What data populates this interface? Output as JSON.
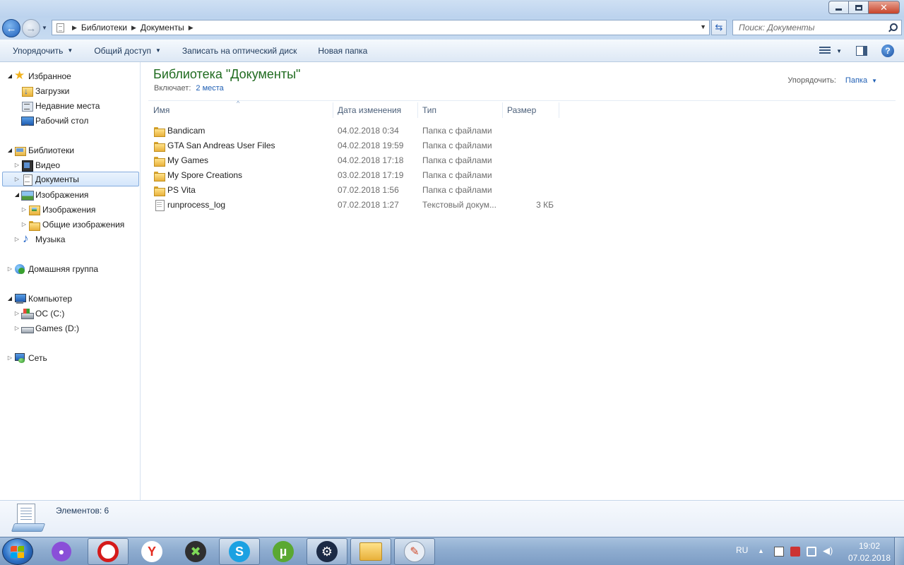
{
  "window": {
    "minimize_icon": "minimize-icon",
    "maximize_icon": "restore-icon",
    "close_icon": "close-icon",
    "close_glyph": "✕"
  },
  "address": {
    "breadcrumbs": [
      "Библиотеки",
      "Документы"
    ],
    "search_placeholder": "Поиск: Документы"
  },
  "toolbar": {
    "organize": "Упорядочить",
    "share": "Общий доступ",
    "burn": "Записать на оптический диск",
    "new_folder": "Новая папка",
    "help": "?"
  },
  "sidebar": {
    "items": [
      {
        "label": "Избранное",
        "icon": "star-icon"
      },
      {
        "label": "Загрузки",
        "icon": "downloads-folder-icon"
      },
      {
        "label": "Недавние места",
        "icon": "recent-places-icon"
      },
      {
        "label": "Рабочий стол",
        "icon": "desktop-icon"
      },
      {
        "label": "Библиотеки",
        "icon": "libraries-icon"
      },
      {
        "label": "Видео",
        "icon": "video-library-icon"
      },
      {
        "label": "Документы",
        "icon": "documents-library-icon"
      },
      {
        "label": "Изображения",
        "icon": "pictures-library-icon"
      },
      {
        "label": "Изображения",
        "icon": "pictures-folder-icon"
      },
      {
        "label": "Общие изображения",
        "icon": "public-pictures-folder-icon"
      },
      {
        "label": "Музыка",
        "icon": "music-library-icon"
      },
      {
        "label": "Домашняя группа",
        "icon": "homegroup-icon"
      },
      {
        "label": "Компьютер",
        "icon": "computer-icon"
      },
      {
        "label": "ОС (C:)",
        "icon": "system-drive-icon"
      },
      {
        "label": "Games (D:)",
        "icon": "drive-icon"
      },
      {
        "label": "Сеть",
        "icon": "network-icon"
      }
    ]
  },
  "library": {
    "title": "Библиотека \"Документы\"",
    "includes_label": "Включает:",
    "includes_link": "2 места",
    "arrange_label": "Упорядочить:",
    "arrange_value": "Папка"
  },
  "columns": [
    "Имя",
    "Дата изменения",
    "Тип",
    "Размер"
  ],
  "files": [
    {
      "name": "Bandicam",
      "date": "04.02.2018 0:34",
      "type": "Папка с файлами",
      "size": "",
      "icon": "folder-icon"
    },
    {
      "name": "GTA San Andreas User Files",
      "date": "04.02.2018 19:59",
      "type": "Папка с файлами",
      "size": "",
      "icon": "folder-icon"
    },
    {
      "name": "My Games",
      "date": "04.02.2018 17:18",
      "type": "Папка с файлами",
      "size": "",
      "icon": "folder-icon"
    },
    {
      "name": "My Spore Creations",
      "date": "03.02.2018 17:19",
      "type": "Папка с файлами",
      "size": "",
      "icon": "folder-icon"
    },
    {
      "name": "PS Vita",
      "date": "07.02.2018 1:56",
      "type": "Папка с файлами",
      "size": "",
      "icon": "folder-icon"
    },
    {
      "name": "runprocess_log",
      "date": "07.02.2018 1:27",
      "type": "Текстовый докум...",
      "size": "3 КБ",
      "icon": "text-file-icon"
    }
  ],
  "status": {
    "items_count": "Элементов: 6"
  },
  "taskbar": {
    "apps": [
      {
        "name": "cortana-mic",
        "glyph": "🎤",
        "color": "#8a4fd8"
      },
      {
        "name": "opera",
        "glyph": "O",
        "color": "#d51a1a"
      },
      {
        "name": "yandex-browser",
        "glyph": "Y",
        "color": "#e42b1f"
      },
      {
        "name": "xbox-app",
        "glyph": "✖",
        "color": "#2f8f2a"
      },
      {
        "name": "skype",
        "glyph": "S",
        "color": "#1ba1e2"
      },
      {
        "name": "utorrent",
        "glyph": "μ",
        "color": "#5aa832"
      },
      {
        "name": "steam",
        "glyph": "⚙",
        "color": "#1b2a45"
      },
      {
        "name": "explorer",
        "glyph": "",
        "color": "#e8b13b"
      },
      {
        "name": "paint",
        "glyph": "",
        "color": "#7fb0e0"
      }
    ],
    "lang": "RU",
    "time": "19:02",
    "date": "07.02.2018"
  }
}
